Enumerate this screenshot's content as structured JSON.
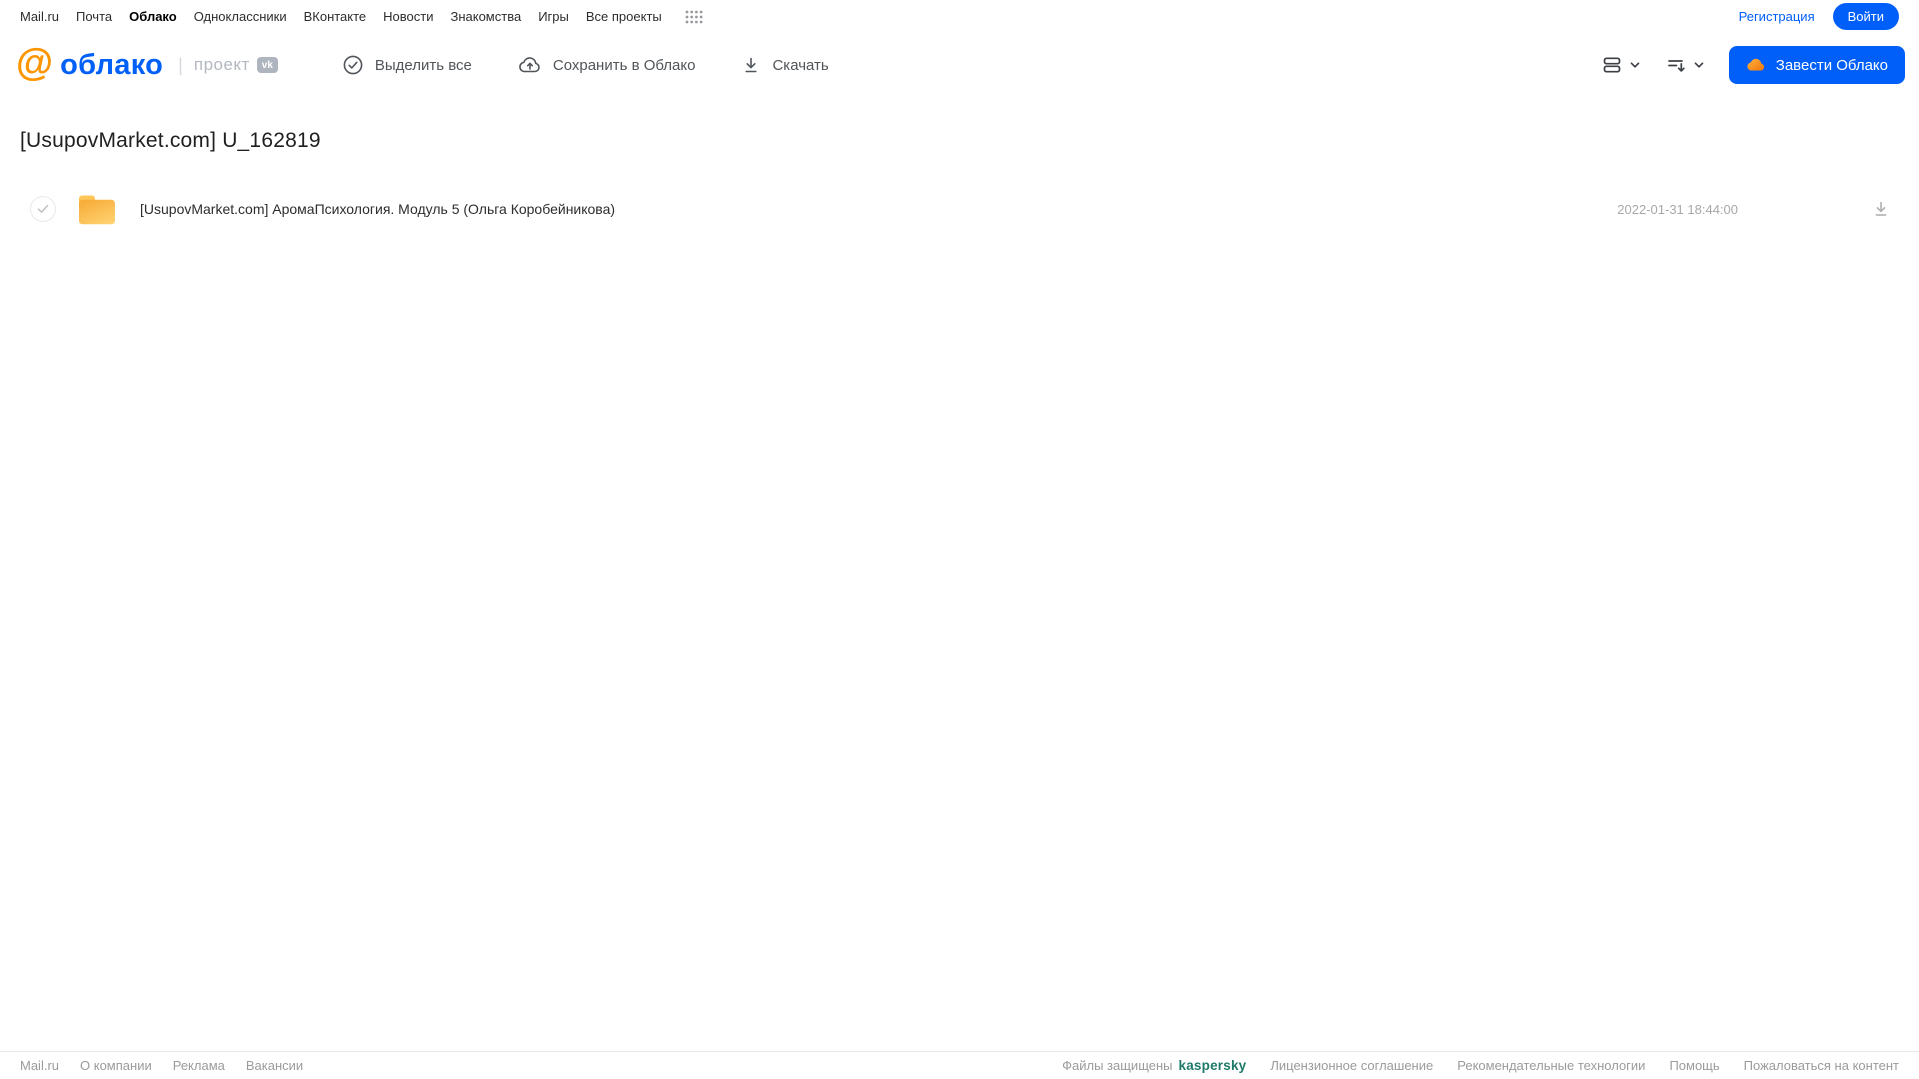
{
  "colors": {
    "accent_blue": "#005FF9",
    "logo_orange": "#FC9502",
    "kaspersky_green": "#1E7A68",
    "folder_yellow": "#F8AE3C"
  },
  "brand": {
    "at": "@",
    "logo": "облако",
    "divider": "|",
    "project": "проект",
    "vk": "vk"
  },
  "top_nav": {
    "items": [
      "Mail.ru",
      "Почта",
      "Облако",
      "Одноклассники",
      "ВКонтакте",
      "Новости",
      "Знакомства",
      "Игры",
      "Все проекты"
    ],
    "registration": "Регистрация",
    "login": "Войти"
  },
  "toolbar": {
    "select_all": "Выделить все",
    "save_to_cloud": "Сохранить в Облако",
    "download": "Скачать",
    "get_cloud": "Завести Облако"
  },
  "main": {
    "title": "[UsupovMarket.com] U_162819"
  },
  "file": {
    "name": "[UsupovMarket.com] АромаПсихология. Модуль 5 (Ольга Коробейникова)",
    "date": "2022-01-31 18:44:00",
    "type": "folder"
  },
  "footer": {
    "links": [
      "Mail.ru",
      "О компании",
      "Реклама",
      "Вакансии"
    ],
    "protected_label": "Файлы защищены",
    "kaspersky": "kaspersky",
    "right_links": [
      "Лицензионное соглашение",
      "Рекомендательные технологии",
      "Помощь",
      "Пожаловаться на контент"
    ]
  }
}
